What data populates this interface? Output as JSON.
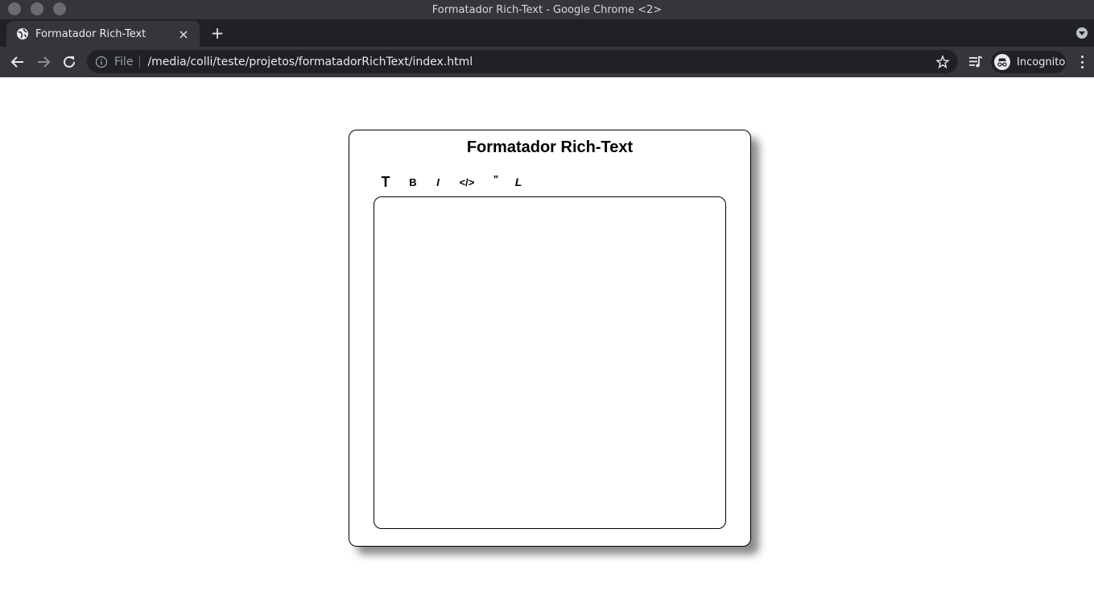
{
  "window": {
    "title": "Formatador Rich-Text - Google Chrome <2>"
  },
  "tabs": [
    {
      "title": "Formatador Rich-Text",
      "close_icon": "×"
    }
  ],
  "new_tab_icon": "+",
  "omnibox": {
    "file_label": "File",
    "url": "/media/colli/teste/projetos/formatadorRichText/index.html"
  },
  "profile": {
    "label": "Incognito"
  },
  "page": {
    "title": "Formatador Rich-Text",
    "format_buttons": {
      "title": "T",
      "bold": "B",
      "italic": "I",
      "code": "</>",
      "quote": "\"",
      "link": "L"
    },
    "editor_text": ""
  },
  "colors": {
    "titlebar": "#35363a",
    "tabstrip": "#202124",
    "toolbar": "#35363a",
    "omnibox": "#202124",
    "page_bg": "#ffffff",
    "card_border": "#000000"
  }
}
